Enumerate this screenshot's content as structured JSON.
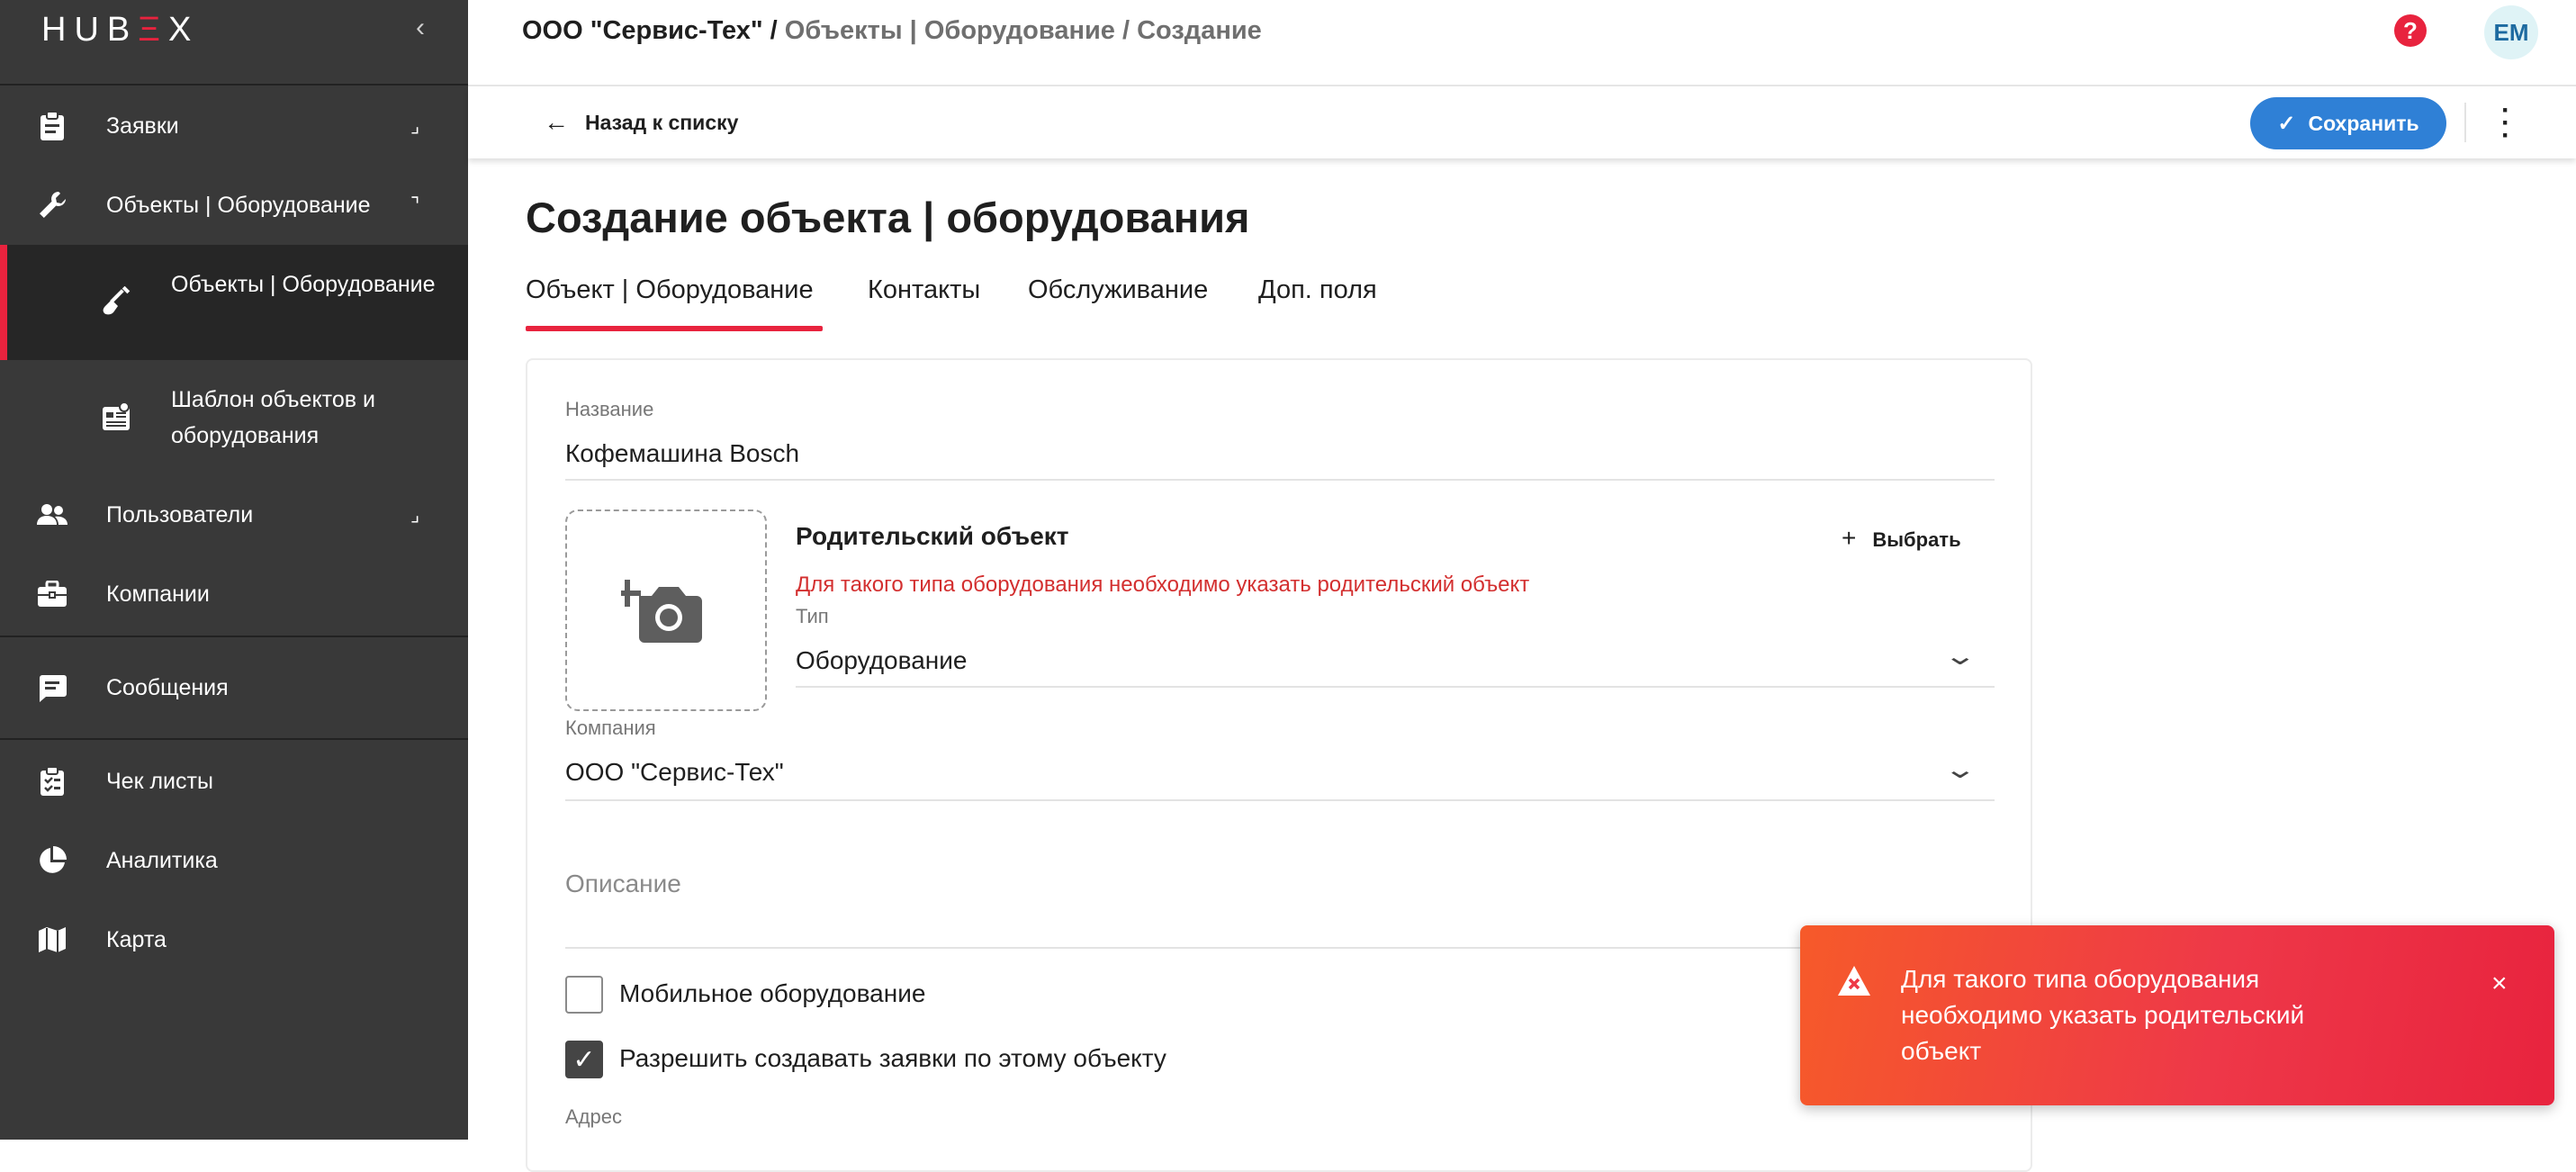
{
  "sidebar": {
    "logo": {
      "pre": "HUB",
      "accent": "Ξ",
      "post": "X"
    },
    "collapse_icon": "chevron-left",
    "items": [
      {
        "label": "Заявки",
        "icon": "clipboard-icon",
        "arrow": "⌟"
      },
      {
        "label": "Объекты | Оборудование",
        "icon": "wrench-icon",
        "arrow": "⌝"
      },
      {
        "label": "Объекты | Оборудование",
        "icon": "shovel-icon",
        "active": true
      },
      {
        "label": "Шаблон объектов и оборудования",
        "icon": "template-icon"
      },
      {
        "label": "Пользователи",
        "icon": "users-icon",
        "arrow": "⌟"
      },
      {
        "label": "Компании",
        "icon": "briefcase-icon"
      },
      {
        "label": "Сообщения",
        "icon": "message-icon"
      },
      {
        "label": "Чек листы",
        "icon": "checklist-icon"
      },
      {
        "label": "Аналитика",
        "icon": "pie-chart-icon"
      },
      {
        "label": "Карта",
        "icon": "map-icon"
      }
    ]
  },
  "header": {
    "breadcrumb_company": "ООО \"Сервис-Тех\" /",
    "breadcrumb_path": "Объекты | Оборудование / Создание",
    "help_glyph": "?",
    "avatar": "EM"
  },
  "toolbar": {
    "back_label": "Назад к списку",
    "save_label": "Сохранить"
  },
  "main": {
    "title": "Создание объекта | оборудования",
    "tabs": [
      {
        "label": "Объект | Оборудование",
        "active": true
      },
      {
        "label": "Контакты"
      },
      {
        "label": "Обслуживание"
      },
      {
        "label": "Доп. поля"
      }
    ]
  },
  "form": {
    "name_label": "Название",
    "name_value": "Кофемашина Bosch",
    "parent_title": "Родительский объект",
    "select_label": "Выбрать",
    "parent_error": "Для такого типа оборудования необходимо указать родительский объект",
    "type_label": "Тип",
    "type_value": "Оборудование",
    "company_label": "Компания",
    "company_value": "ООО \"Сервис-Тех\"",
    "description_placeholder": "Описание",
    "mobile_label": "Мобильное оборудование",
    "mobile_checked": false,
    "allow_label": "Разрешить создавать заявки по этому объекту",
    "allow_checked": true,
    "address_label": "Адрес"
  },
  "toast": {
    "message": "Для такого типа оборудования необходимо указать родительский объект",
    "close": "×"
  },
  "colors": {
    "accent": "#e8233e",
    "primary": "#2f80d6",
    "sidebar": "#393939",
    "error": "#d32f2f"
  }
}
